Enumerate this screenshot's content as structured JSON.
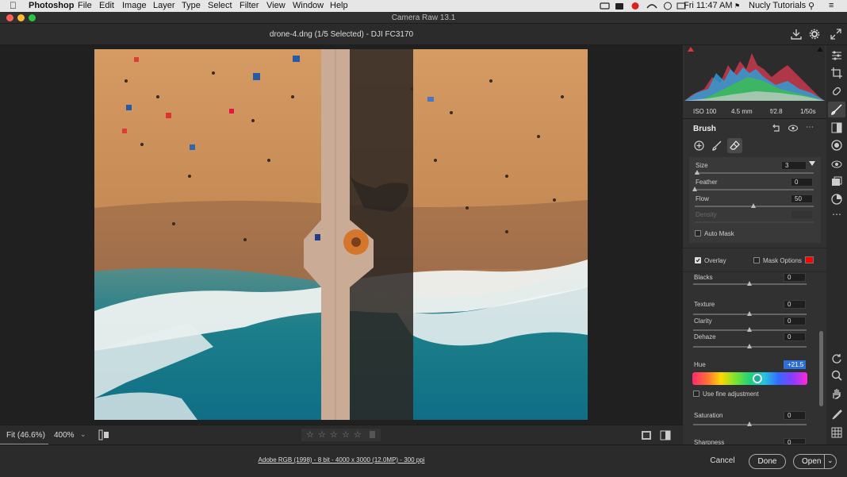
{
  "menubar": {
    "apple": "",
    "app_name": "Photoshop",
    "items": [
      "File",
      "Edit",
      "Image",
      "Layer",
      "Type",
      "Select",
      "Filter",
      "View",
      "Window",
      "Help"
    ],
    "clock": "Fri 11:47 AM",
    "user": "Nucly Tutorials"
  },
  "window": {
    "title": "Camera Raw 13.1"
  },
  "document": {
    "title": "drone-4.dng (1/5 Selected)  -  DJI FC3170"
  },
  "camera_info": {
    "iso": "ISO 100",
    "focal": "4.5 mm",
    "aperture": "f/2.8",
    "shutter": "1/50s"
  },
  "brush_panel": {
    "title": "Brush",
    "size": {
      "label": "Size",
      "value": "3",
      "pos": 0.02
    },
    "feather": {
      "label": "Feather",
      "value": "0",
      "pos": 0.0
    },
    "flow": {
      "label": "Flow",
      "value": "50",
      "pos": 0.5
    },
    "density": {
      "label": "Density",
      "value": ""
    },
    "auto_mask": {
      "label": "Auto Mask",
      "checked": false
    },
    "overlay": {
      "label": "Overlay",
      "checked": true
    },
    "mask_options": {
      "label": "Mask Options",
      "checked": false,
      "color": "#ff0000"
    }
  },
  "adjustments": {
    "blacks": {
      "label": "Blacks",
      "value": "0",
      "pos": 0.5
    },
    "texture": {
      "label": "Texture",
      "value": "0",
      "pos": 0.5
    },
    "clarity": {
      "label": "Clarity",
      "value": "0",
      "pos": 0.5
    },
    "dehaze": {
      "label": "Dehaze",
      "value": "0",
      "pos": 0.5
    },
    "hue": {
      "label": "Hue",
      "value": "+21.5",
      "pos": 0.56
    },
    "fine_adjust": {
      "label": "Use fine adjustment",
      "checked": false
    },
    "saturation": {
      "label": "Saturation",
      "value": "0",
      "pos": 0.5
    },
    "sharpness": {
      "label": "Sharpness",
      "value": "0"
    }
  },
  "footer": {
    "fit": "Fit (46.6%)",
    "zoom": "400%",
    "rating_stars": 5,
    "file_info": "Adobe RGB (1998) - 8 bit - 4000 x 3000 (12.0MP) - 300 ppi"
  },
  "buttons": {
    "cancel": "Cancel",
    "done": "Done",
    "open": "Open"
  },
  "colors": {
    "accent": "#2d6fd6",
    "mask_color": "#ff0000",
    "panel": "#313131"
  }
}
